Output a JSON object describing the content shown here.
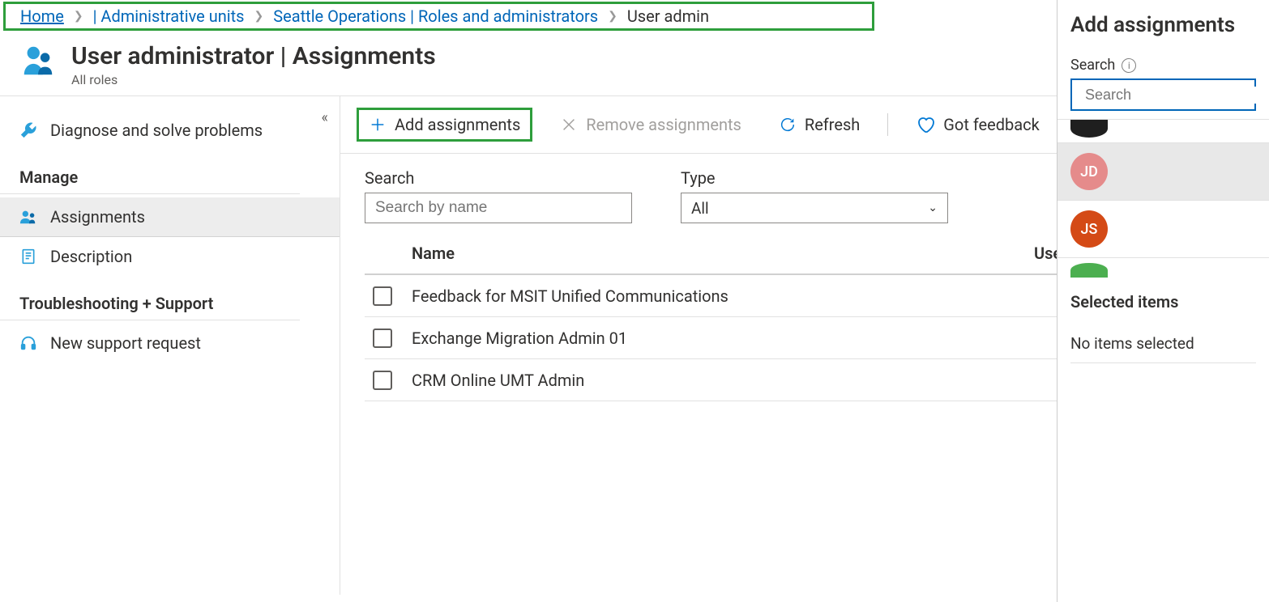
{
  "breadcrumb": {
    "home": "Home",
    "admin_units": "| Administrative units",
    "seattle_ops": "Seattle Operations | Roles and administrators",
    "current": "User admin"
  },
  "header": {
    "title": "User administrator | Assignments",
    "subtitle": "All roles"
  },
  "left_nav": {
    "diagnose": "Diagnose and solve problems",
    "section_manage": "Manage",
    "assignments": "Assignments",
    "description": "Description",
    "section_troubleshoot": "Troubleshooting + Support",
    "support_request": "New support request"
  },
  "toolbar": {
    "add": "Add assignments",
    "remove": "Remove assignments",
    "refresh": "Refresh",
    "feedback": "Got feedback"
  },
  "filters": {
    "search_label": "Search",
    "search_placeholder": "Search by name",
    "type_label": "Type",
    "type_value": "All"
  },
  "table": {
    "col_name": "Name",
    "col_username": "UserName",
    "rows": [
      {
        "name": "Feedback for MSIT Unified Communications"
      },
      {
        "name": "Exchange Migration Admin 01"
      },
      {
        "name": "CRM Online UMT Admin"
      }
    ]
  },
  "flyout": {
    "title": "Add assignments",
    "search_label": "Search",
    "search_placeholder": "Search",
    "items": [
      {
        "initials": "",
        "color": "#1f1f1f",
        "half": true
      },
      {
        "initials": "JD",
        "color": "#e58b8b",
        "selected": true
      },
      {
        "initials": "JS",
        "color": "#d44a16"
      },
      {
        "initials": "",
        "color": "#4caf50",
        "half_bottom": true
      }
    ],
    "selected_title": "Selected items",
    "selected_empty": "No items selected"
  }
}
